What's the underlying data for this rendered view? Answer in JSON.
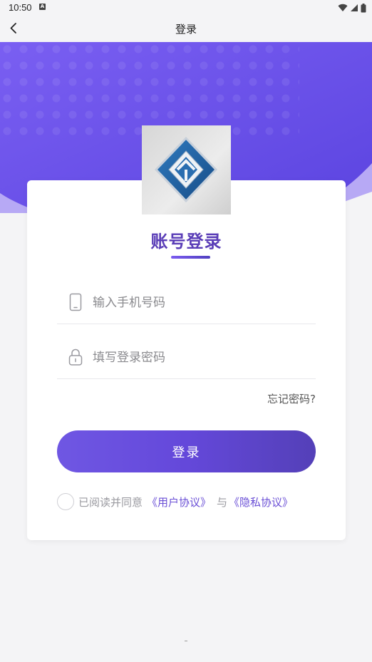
{
  "status_bar": {
    "time": "10:50",
    "notification_icon": "a-icon",
    "icons": [
      "wifi-icon",
      "signal-icon",
      "battery-icon"
    ]
  },
  "nav": {
    "back_icon": "chevron-left-icon",
    "title": "登录"
  },
  "colors": {
    "brand": "#6a4fd6",
    "title": "#5a3db7",
    "hero_start": "#7a5ff2",
    "hero_end": "#5b44e0",
    "button_start": "#6f57e3",
    "button_end": "#5440b8"
  },
  "logo": {
    "icon": "app-logo-diamond-icon"
  },
  "login_form": {
    "title": "账号登录",
    "phone_icon": "phone-icon",
    "phone_placeholder": "输入手机号码",
    "phone_value": "",
    "password_icon": "lock-icon",
    "password_placeholder": "填写登录密码",
    "password_value": "",
    "forgot_password": "忘记密码?",
    "submit_label": "登录"
  },
  "agreement": {
    "checked": false,
    "prefix": "已阅读并同意",
    "user_agreement": "《用户协议》",
    "and": "与",
    "privacy_policy": "《隐私协议》"
  }
}
